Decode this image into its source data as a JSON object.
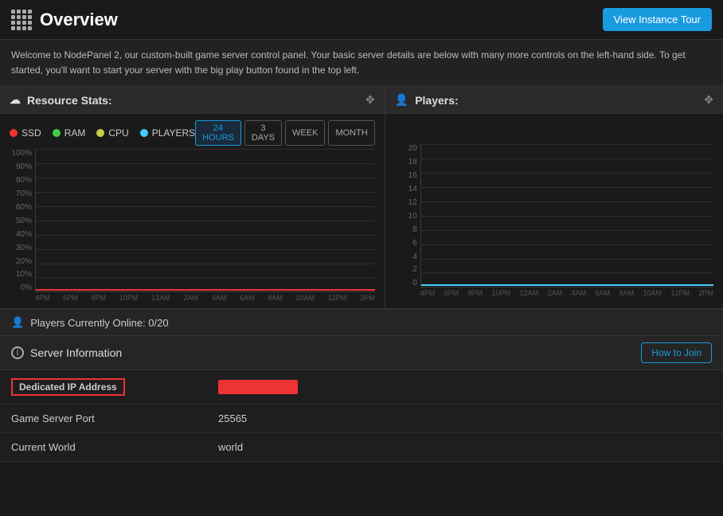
{
  "header": {
    "title": "Overview",
    "tour_button": "View Instance Tour"
  },
  "welcome": {
    "text": "Welcome to NodePanel 2, our custom-built game server control panel. Your basic server details are below with many more controls on the left-hand side. To get started, you'll want to start your server with the big play button found in the top left."
  },
  "resource_stats": {
    "title": "Resource Stats:",
    "legend": [
      {
        "id": "ssd",
        "label": "SSD",
        "color": "#e33"
      },
      {
        "id": "ram",
        "label": "RAM",
        "color": "#4c4"
      },
      {
        "id": "cpu",
        "label": "CPU",
        "color": "#cc4"
      },
      {
        "id": "players",
        "label": "PLAYERS",
        "color": "#4cf"
      }
    ],
    "time_buttons": [
      {
        "id": "24h",
        "label": "24 HOURS",
        "active": true
      },
      {
        "id": "3d",
        "label": "3 DAYS",
        "active": false
      },
      {
        "id": "week",
        "label": "WEEK",
        "active": false
      },
      {
        "id": "month",
        "label": "MONTH",
        "active": false
      }
    ],
    "y_labels": [
      "100%",
      "90%",
      "80%",
      "70%",
      "60%",
      "50%",
      "40%",
      "30%",
      "20%",
      "10%",
      "0%"
    ],
    "x_labels": [
      "4PM",
      "6PM",
      "8PM",
      "10PM",
      "12AM",
      "2AM",
      "4AM",
      "6AM",
      "8AM",
      "10AM",
      "12PM",
      "2PM"
    ]
  },
  "players_panel": {
    "title": "Players:",
    "y_labels": [
      "20",
      "18",
      "16",
      "14",
      "12",
      "10",
      "8",
      "6",
      "4",
      "2",
      "0"
    ],
    "x_labels": [
      "4PM",
      "6PM",
      "8PM",
      "10PM",
      "12AM",
      "2AM",
      "4AM",
      "6AM",
      "8AM",
      "10AM",
      "12PM",
      "2PM"
    ]
  },
  "players_online": {
    "text": "Players Currently Online: 0/20"
  },
  "server_information": {
    "title": "Server Information",
    "how_join_btn": "How to Join",
    "rows": [
      {
        "label": "Dedicated IP Address",
        "value": "",
        "is_ip": true
      },
      {
        "label": "Game Server Port",
        "value": "25565"
      },
      {
        "label": "Current World",
        "value": "world"
      }
    ]
  }
}
